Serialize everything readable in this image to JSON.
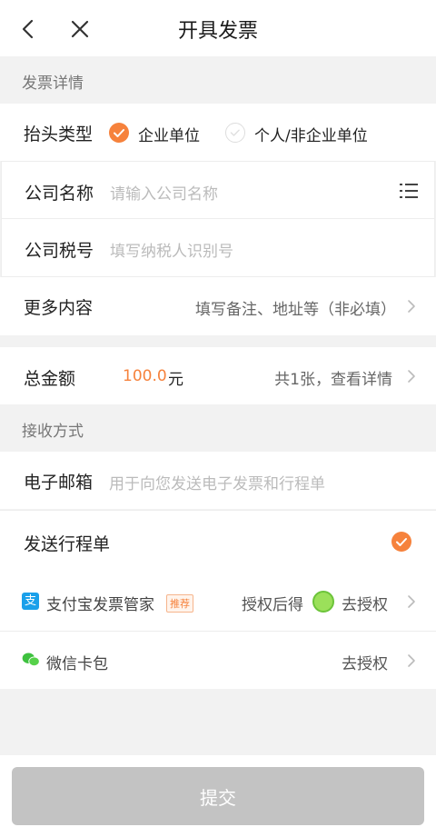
{
  "nav": {
    "title": "开具发票"
  },
  "invoice_details": {
    "section_title": "发票详情",
    "title_type": {
      "label": "抬头类型",
      "option_company": "企业单位",
      "option_personal": "个人/非企业单位",
      "selected": "企业单位"
    },
    "company_name": {
      "label": "公司名称",
      "placeholder": "请输入公司名称"
    },
    "tax_number": {
      "label": "公司税号",
      "placeholder": "填写纳税人识别号"
    },
    "more_content": {
      "label": "更多内容",
      "hint": "填写备注、地址等（非必填）"
    }
  },
  "total": {
    "label": "总金额",
    "amount": "100.0",
    "unit": "元",
    "detail": "共1张，查看详情"
  },
  "receive": {
    "section_title": "接收方式",
    "email": {
      "label": "电子邮箱",
      "placeholder": "用于向您发送电子发票和行程单"
    },
    "send_itinerary": {
      "label": "发送行程单",
      "checked": true
    },
    "alipay": {
      "name": "支付宝发票管家",
      "badge": "推荐",
      "reward_text": "授权后得",
      "action": "去授权"
    },
    "wechat": {
      "name": "微信卡包",
      "action": "去授权"
    }
  },
  "submit_label": "提交",
  "colors": {
    "accent": "#f6823c",
    "alipay_blue": "#1aa0ea",
    "wechat_green": "#3ec13f",
    "submit_disabled": "#c3c3c3"
  }
}
